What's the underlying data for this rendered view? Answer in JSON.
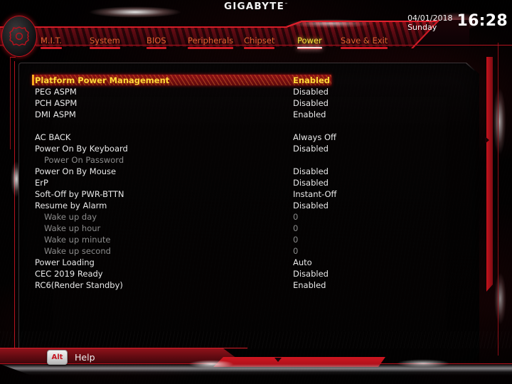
{
  "brand": {
    "name": "GIGABYTE",
    "tm": "™",
    "logo_icon": "gear-icon"
  },
  "clock": {
    "date": "04/01/2018",
    "weekday": "Sunday",
    "time": "16:28"
  },
  "tabs": [
    {
      "label": "M.I.T.",
      "active": false
    },
    {
      "label": "System",
      "active": false
    },
    {
      "label": "BIOS",
      "active": false
    },
    {
      "label": "Peripherals",
      "active": false
    },
    {
      "label": "Chipset",
      "active": false
    },
    {
      "label": "Power",
      "active": true
    },
    {
      "label": "Save & Exit",
      "active": false
    }
  ],
  "settings": [
    {
      "name": "Platform Power Management",
      "value": "Enabled",
      "state": "selected"
    },
    {
      "name": "PEG ASPM",
      "value": "Disabled",
      "state": "normal"
    },
    {
      "name": "PCH ASPM",
      "value": "Disabled",
      "state": "normal"
    },
    {
      "name": "DMI ASPM",
      "value": "Enabled",
      "state": "normal"
    },
    {
      "name": "",
      "value": "",
      "state": "spacer"
    },
    {
      "name": "AC BACK",
      "value": "Always Off",
      "state": "normal"
    },
    {
      "name": "Power On By Keyboard",
      "value": "Disabled",
      "state": "normal"
    },
    {
      "name": "Power On Password",
      "value": "",
      "state": "dim-sub"
    },
    {
      "name": "Power On By Mouse",
      "value": "Disabled",
      "state": "normal"
    },
    {
      "name": "ErP",
      "value": "Disabled",
      "state": "normal"
    },
    {
      "name": "Soft-Off by PWR-BTTN",
      "value": "Instant-Off",
      "state": "normal"
    },
    {
      "name": "Resume by Alarm",
      "value": "Disabled",
      "state": "normal"
    },
    {
      "name": "Wake up day",
      "value": "0",
      "state": "dim-sub"
    },
    {
      "name": "Wake up hour",
      "value": "0",
      "state": "dim-sub"
    },
    {
      "name": "Wake up minute",
      "value": "0",
      "state": "dim-sub"
    },
    {
      "name": "Wake up second",
      "value": "0",
      "state": "dim-sub"
    },
    {
      "name": "Power Loading",
      "value": "Auto",
      "state": "normal"
    },
    {
      "name": "CEC 2019 Ready",
      "value": "Disabled",
      "state": "normal"
    },
    {
      "name": "RC6(Render Standby)",
      "value": "Enabled",
      "state": "normal"
    }
  ],
  "footer": {
    "key": "Alt",
    "label": "Help"
  },
  "colors": {
    "accent_red": "#c4121d",
    "tab_text": "#e0612f",
    "tab_active_text": "#f5e23c",
    "selected_text": "#ffd83a",
    "value_text": "#e9e9e9",
    "dim_text": "#8b8b8b",
    "panel_bg": "#050303",
    "key_text": "#c41520"
  }
}
